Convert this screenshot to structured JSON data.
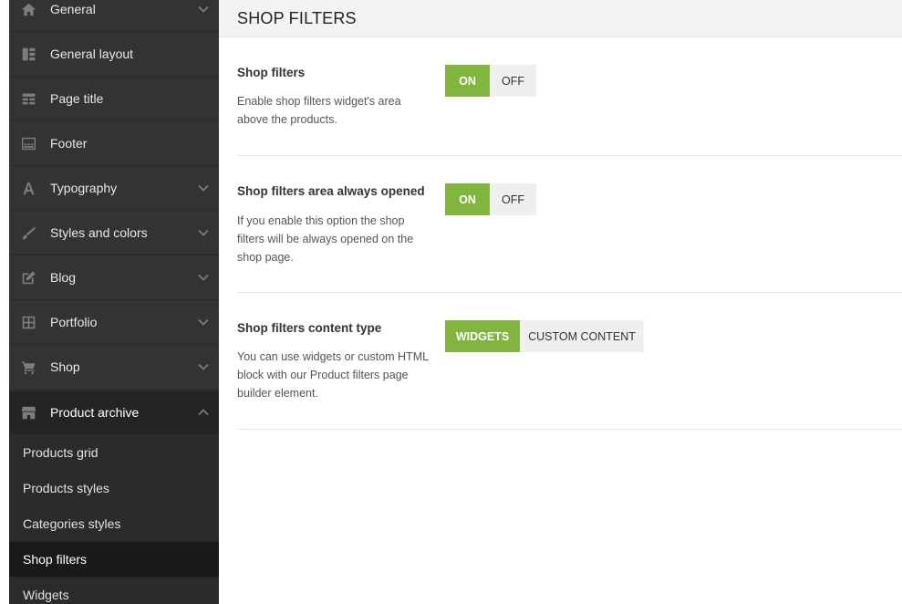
{
  "sidebar": {
    "items": [
      {
        "label": "General",
        "icon": "home-icon",
        "has_chevron": true
      },
      {
        "label": "General layout",
        "icon": "layout-icon",
        "has_chevron": false
      },
      {
        "label": "Page title",
        "icon": "page-title-icon",
        "has_chevron": false
      },
      {
        "label": "Footer",
        "icon": "footer-icon",
        "has_chevron": false
      },
      {
        "label": "Typography",
        "icon": "typography-icon",
        "has_chevron": true
      },
      {
        "label": "Styles and colors",
        "icon": "brush-icon",
        "has_chevron": true
      },
      {
        "label": "Blog",
        "icon": "edit-icon",
        "has_chevron": true
      },
      {
        "label": "Portfolio",
        "icon": "grid-icon",
        "has_chevron": true
      },
      {
        "label": "Shop",
        "icon": "cart-icon",
        "has_chevron": true
      },
      {
        "label": "Product archive",
        "icon": "store-icon",
        "has_chevron": true,
        "expanded": true
      }
    ],
    "subitems": [
      {
        "label": "Products grid"
      },
      {
        "label": "Products styles"
      },
      {
        "label": "Categories styles"
      },
      {
        "label": "Shop filters",
        "current": true
      },
      {
        "label": "Widgets"
      }
    ]
  },
  "main": {
    "title": "SHOP FILTERS",
    "options": [
      {
        "title": "Shop filters",
        "description": "Enable shop filters widget's area above the products.",
        "choices": [
          "ON",
          "OFF"
        ],
        "selected": "ON"
      },
      {
        "title": "Shop filters area always opened",
        "description": "If you enable this option the shop filters will be always opened on the shop page.",
        "choices": [
          "ON",
          "OFF"
        ],
        "selected": "ON"
      },
      {
        "title": "Shop filters content type",
        "description": "You can use widgets or custom HTML block with our Product filters page builder element.",
        "choices": [
          "WIDGETS",
          "CUSTOM CONTENT"
        ],
        "selected": "WIDGETS"
      }
    ]
  },
  "colors": {
    "sidebar_bg": "#333333",
    "accent_green": "#82b440",
    "header_bg": "#f3f3f3"
  }
}
